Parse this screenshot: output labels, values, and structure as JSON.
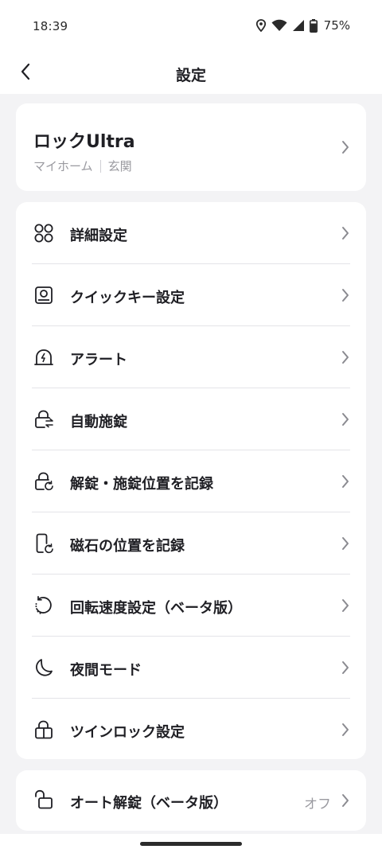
{
  "status_bar": {
    "time": "18:39",
    "battery": "75%",
    "icons": [
      "location-icon",
      "wifi-icon",
      "signal-icon",
      "battery-icon"
    ]
  },
  "header": {
    "title": "設定",
    "back_icon": "back-arrow-icon"
  },
  "device": {
    "name": "ロックUltra",
    "home": "マイホーム",
    "room": "玄関"
  },
  "menu": {
    "items": [
      {
        "label": "詳細設定",
        "icon": "grid-icon"
      },
      {
        "label": "クイックキー設定",
        "icon": "quick-key-icon"
      },
      {
        "label": "アラート",
        "icon": "alert-icon"
      },
      {
        "label": "自動施錠",
        "icon": "auto-lock-icon"
      },
      {
        "label": "解錠・施錠位置を記録",
        "icon": "lock-position-icon"
      },
      {
        "label": "磁石の位置を記録",
        "icon": "magnet-position-icon"
      },
      {
        "label": "回転速度設定（ベータ版）",
        "icon": "rotation-speed-icon"
      },
      {
        "label": "夜間モード",
        "icon": "moon-icon"
      },
      {
        "label": "ツインロック設定",
        "icon": "twin-lock-icon"
      }
    ]
  },
  "auto_unlock": {
    "label": "オート解錠（ベータ版）",
    "value": "オフ",
    "icon": "unlock-icon"
  },
  "colors": {
    "background": "#f3f3f5",
    "card": "#ffffff",
    "text": "#1f1f24",
    "secondary_text": "#9a9aa0"
  }
}
